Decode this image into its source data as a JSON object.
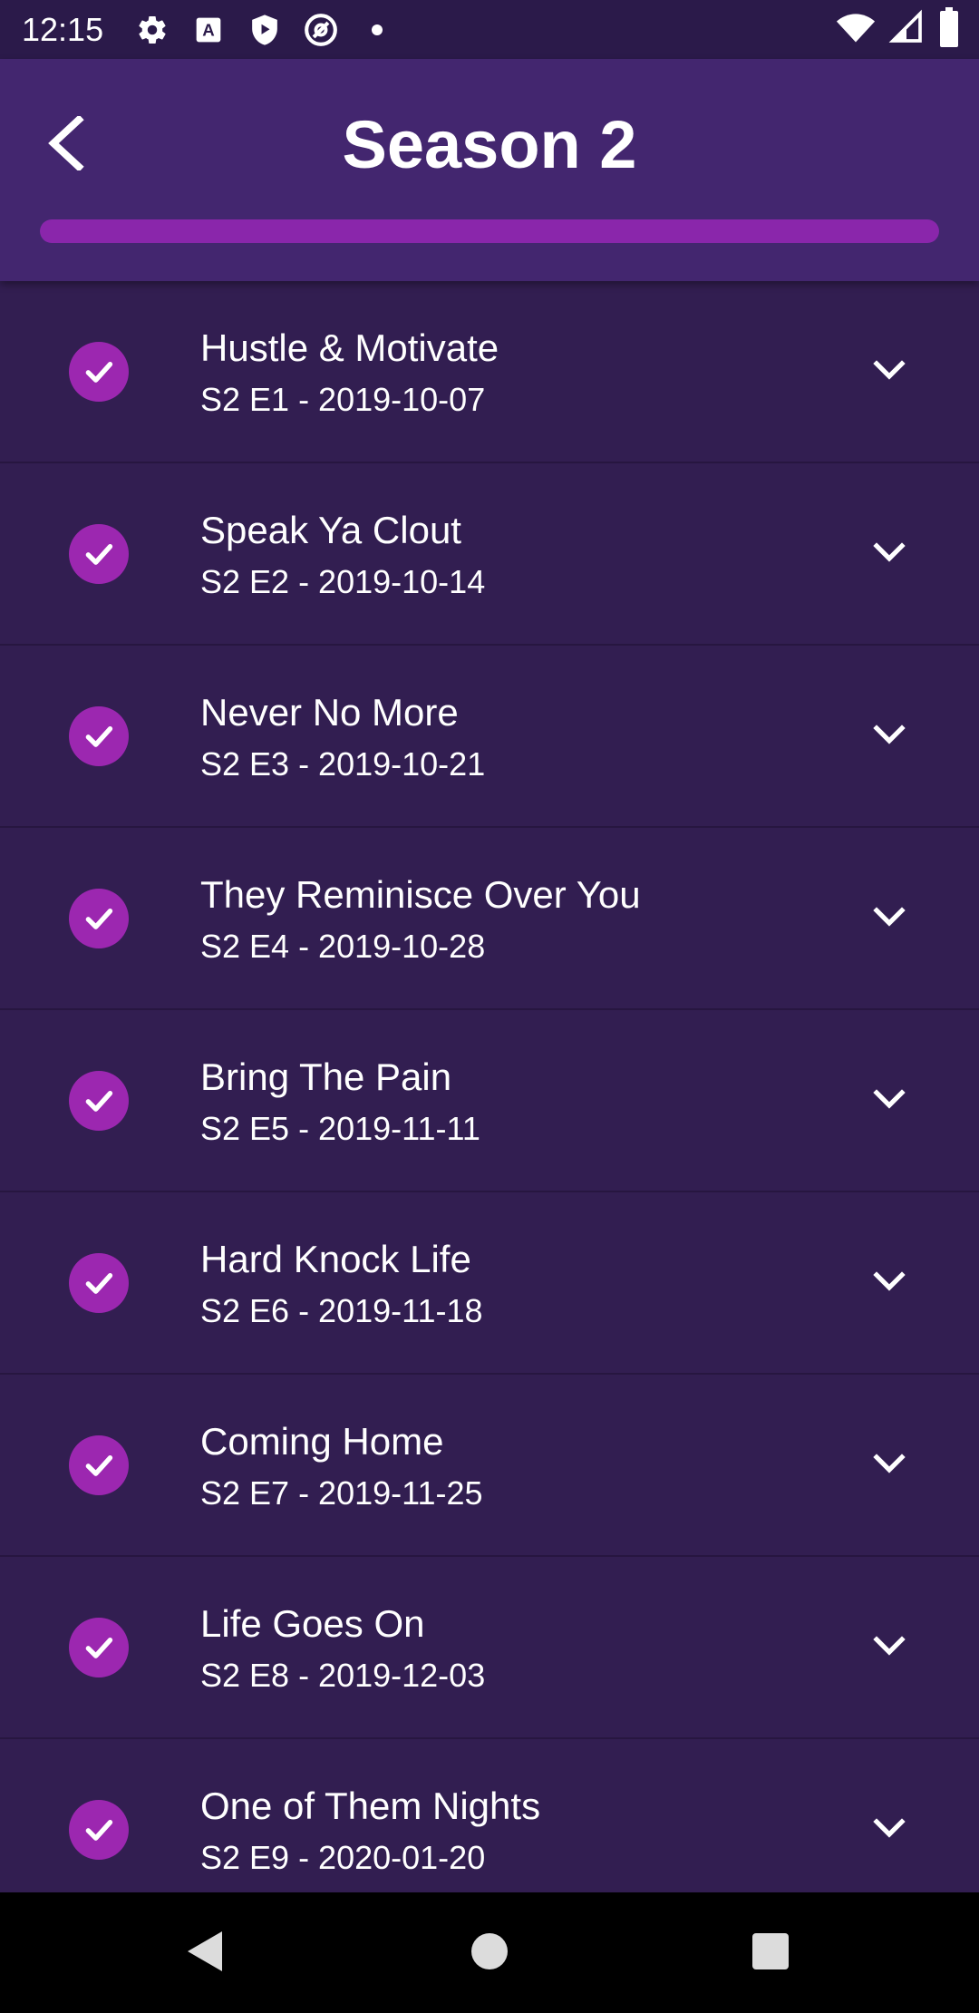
{
  "status_bar": {
    "time": "12:15",
    "icons_left": [
      "settings-icon",
      "font-a-icon",
      "play-shield-icon",
      "at-sign-icon",
      "dot-icon"
    ],
    "icons_right": [
      "wifi-icon",
      "signal-icon",
      "battery-icon"
    ]
  },
  "header": {
    "title": "Season 2",
    "back_icon": "chevron-left-icon",
    "progress_fraction": 1.0,
    "progress_color": "#8a26ab"
  },
  "colors": {
    "background": "#311d50",
    "app_bar": "#43266f",
    "accent": "#9c27b0"
  },
  "episodes": [
    {
      "title": "Hustle & Motivate",
      "meta": "S2 E1 - 2019-10-07"
    },
    {
      "title": "Speak Ya Clout",
      "meta": "S2 E2 - 2019-10-14"
    },
    {
      "title": "Never No More",
      "meta": "S2 E3 - 2019-10-21"
    },
    {
      "title": "They Reminisce Over You",
      "meta": "S2 E4 - 2019-10-28"
    },
    {
      "title": "Bring The Pain",
      "meta": "S2 E5 - 2019-11-11"
    },
    {
      "title": "Hard Knock Life",
      "meta": "S2 E6 - 2019-11-18"
    },
    {
      "title": "Coming Home",
      "meta": "S2 E7 - 2019-11-25"
    },
    {
      "title": "Life Goes On",
      "meta": "S2 E8 - 2019-12-03"
    },
    {
      "title": "One of Them Nights",
      "meta": "S2 E9 - 2020-01-20"
    }
  ],
  "nav_bar": {
    "buttons": [
      "back-triangle-icon",
      "home-circle-icon",
      "recents-square-icon"
    ]
  }
}
